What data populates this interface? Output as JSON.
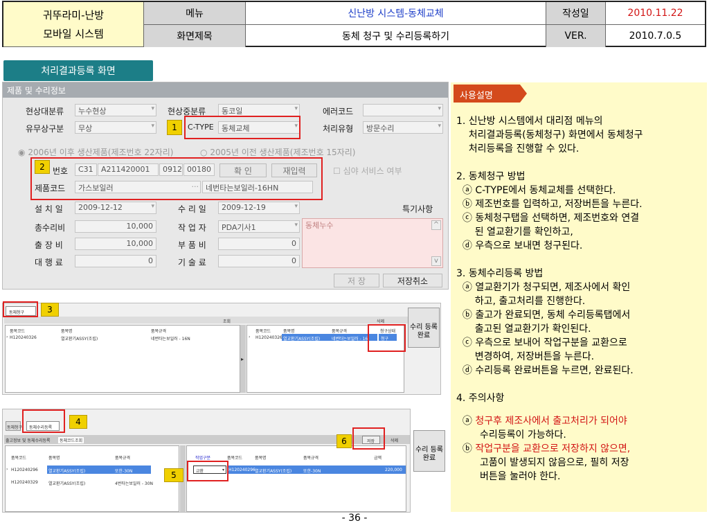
{
  "header": {
    "system_name_1": "귀뚜라미-난방",
    "system_name_2": "모바일 시스템",
    "menu_label": "메뉴",
    "menu_value": "신난방 시스템-동체교체",
    "date_label": "작성일",
    "date_value": "2010.11.22",
    "screen_label": "화면제목",
    "screen_value": "동체 청구 및 수리등록하기",
    "ver_label": "VER.",
    "ver_value": "2010.7.0.5"
  },
  "section_tag": "처리결과등록 화면",
  "app": {
    "title": "제품 및 수리정보",
    "row1": {
      "l1": "현상대분류",
      "v1": "누수현상",
      "l2": "현상중분류",
      "v2": "동코일",
      "l3": "에러코드",
      "v3": ""
    },
    "row2": {
      "l1": "유무상구분",
      "v1": "무상",
      "l2": "C-TYPE",
      "v2": "동체교체",
      "l3": "처리유형",
      "v3": "방문수리"
    },
    "radio1": "2006년 이후 생산제품(제조번호 22자리)",
    "radio2": "2005년 이전 생산제품(제조번호 15자리)",
    "serial_label": "번호",
    "serial": [
      "C31",
      "A211420001",
      "0912",
      "00180"
    ],
    "confirm_btn": "확 인",
    "reinput_btn": "재입력",
    "night_service": "심야 서비스 여부",
    "product_code_label": "제품코드",
    "product_code": "가스보일러",
    "product_name": "네번타는보일러-16HN",
    "install_label": "설 치 일",
    "install_date": "2009-12-12",
    "repair_label": "수 리 일",
    "repair_date": "2009-12-19",
    "special_label": "특기사항",
    "total_label": "총수리비",
    "total": "10,000",
    "worker_label": "작 업 자",
    "worker": "PDA기사1",
    "trip_label": "출 장 비",
    "trip": "10,000",
    "parts_label": "부 품 비",
    "parts": "0",
    "agency_label": "대 행 료",
    "agency": "0",
    "tech_label": "기 술 료",
    "tech": "0",
    "note": "동체누수",
    "save_btn": "저 장",
    "cancel_btn": "저장취소"
  },
  "markers": [
    "1",
    "2",
    "3",
    "4",
    "5",
    "6"
  ],
  "screen2": {
    "tab": "동체청구",
    "lookup": "조회",
    "delete": "삭제",
    "left_cols": [
      "품목코드",
      "품목명",
      "품목규격"
    ],
    "left_row": [
      "H120240326",
      "열교환기ASSY(조립)",
      "네번타는보일러 - 16N"
    ],
    "right_cols": [
      "품목코드",
      "품목명",
      "품목규격",
      "청구상태"
    ],
    "right_row": [
      "H120240326",
      "열교환기ASSY(조립)",
      "네번타는보일러 - 16",
      "청구"
    ],
    "side_btn_1": "수리 등록",
    "side_btn_2": "완료"
  },
  "screen3": {
    "tab1": "동체청구",
    "tab2": "동체수리등록",
    "sub1": "출고정보 및 동체수리등록",
    "sub2": "동체코드조회",
    "save": "저장",
    "delete": "삭제",
    "left_cols": [
      "품목코드",
      "품목명",
      "품목규격"
    ],
    "left_rows": [
      [
        "H120240296",
        "열교환기ASSY(조립)",
        "또한-30N"
      ],
      [
        "H120240329",
        "열교환기ASSY(조립)",
        "4번타는보일러 - 30N"
      ]
    ],
    "right_cols": [
      "작업구분",
      "품목코드",
      "품목명",
      "품목규격",
      "금액"
    ],
    "right_row": [
      "교환",
      "H120240296",
      "열교환기ASSY(조립)",
      "또한-30N",
      "220,000"
    ],
    "side_btn_1": "수리 등록",
    "side_btn_2": "완료"
  },
  "panel": {
    "tag": "사용설명",
    "lines": [
      "1. 신난방 시스템에서 대리점 메뉴의",
      "    처리결과등록(동체청구) 화면에서 동체청구",
      "    처리등록을 진행할 수 있다.",
      "",
      "2. 동체청구 방법",
      "  ⓐ C-TYPE에서 동체교체를 선택한다.",
      "  ⓑ 제조번호를 입력하고, 저장버튼을 누른다.",
      "  ⓒ 동체청구탭을 선택하면, 제조번호와 연결",
      "      된 열교환기를 확인하고,",
      "  ⓓ 우측으로 보내면 청구된다.",
      "",
      "3. 동체수리등록 방법",
      "  ⓐ 열교환기가 청구되면, 제조사에서 확인",
      "      하고, 출고처리를 진행한다.",
      "  ⓑ 출고가 완료되면, 동체 수리등록탭에서",
      "      출고된 열교환기가 확인된다.",
      "  ⓒ 우측으로 보내어 작업구분을 교환으로",
      "      변경하여, 저장버튼을 누른다.",
      "  ⓓ 수리등록 완료버튼을 누르면, 완료된다.",
      "",
      "4. 주의사항"
    ],
    "warn_a_prefix": "  ⓐ ",
    "warn_a_1": "청구후 제조사에서 출고처리가 되어야",
    "warn_a_2": "수리등록이 가능하다.",
    "warn_b_prefix": "  ⓑ ",
    "warn_b_1": "작업구분을 교환으로 저장하지 않으면,",
    "warn_b_2": "고품이 발생되지 않음으로, 필히 저장",
    "warn_b_3": "버튼을 눌러야 한다."
  },
  "page_number": "- 36 -"
}
